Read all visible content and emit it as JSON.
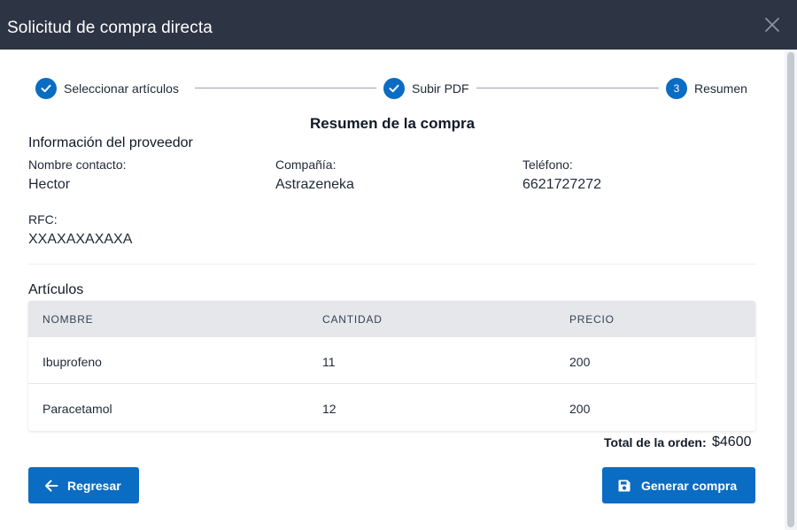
{
  "dialog": {
    "title": "Solicitud de compra directa",
    "close_icon": "close-icon"
  },
  "stepper": {
    "steps": [
      {
        "number": "1",
        "label": "Seleccionar artículos",
        "state": "completed"
      },
      {
        "number": "2",
        "label": "Subir PDF",
        "state": "completed"
      },
      {
        "number": "3",
        "label": "Resumen",
        "state": "active"
      }
    ],
    "accent": "#0a6cc2"
  },
  "summary": {
    "title": "Resumen de la compra"
  },
  "provider": {
    "section_title": "Información del proveedor",
    "contact_label": "Nombre contacto:",
    "contact_value": "Hector",
    "company_label": "Compañía:",
    "company_value": "Astrazeneka",
    "phone_label": "Teléfono:",
    "phone_value": "6621727272",
    "rfc_label": "RFC:",
    "rfc_value": "XXAXAXAXAXA"
  },
  "items": {
    "section_title": "Artículos",
    "columns": [
      "NOMBRE",
      "CANTIDAD",
      "PRECIO"
    ],
    "rows": [
      {
        "name": "Ibuprofeno",
        "quantity": "11",
        "price": "200"
      },
      {
        "name": "Paracetamol",
        "quantity": "12",
        "price": "200"
      }
    ]
  },
  "total": {
    "label": "Total de la orden:",
    "value": "$4600"
  },
  "actions": {
    "back_label": "Regresar",
    "back_icon": "arrow-left-icon",
    "generate_label": "Generar compra",
    "generate_icon": "save-icon"
  },
  "colors": {
    "header_bg": "#2d3444",
    "primary": "#0a6cc2",
    "table_header_bg": "#e5e7eb"
  }
}
